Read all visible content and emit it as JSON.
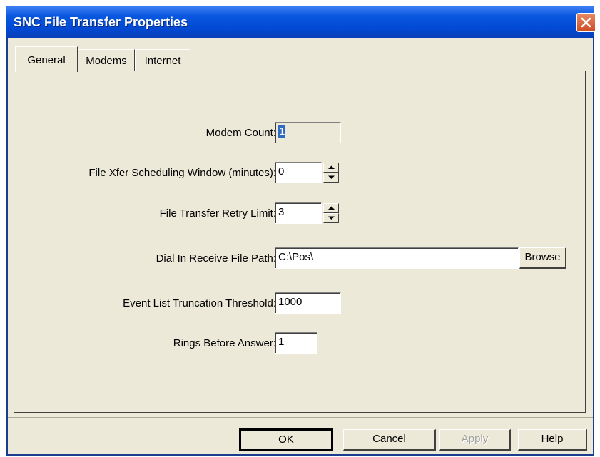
{
  "window": {
    "title": "SNC File Transfer Properties"
  },
  "tabs": [
    {
      "label": "General",
      "active": true
    },
    {
      "label": "Modems",
      "active": false
    },
    {
      "label": "Internet",
      "active": false
    }
  ],
  "fields": {
    "modem_count": {
      "label": "Modem Count:",
      "value": "1"
    },
    "scheduling_window": {
      "label": "File Xfer Scheduling Window (minutes):",
      "value": "0"
    },
    "retry_limit": {
      "label": "File Transfer Retry Limit:",
      "value": "3"
    },
    "receive_path": {
      "label": "Dial In Receive File Path:",
      "value": "C:\\Pos\\",
      "browse_label": "Browse"
    },
    "truncation_threshold": {
      "label": "Event List Truncation Threshold:",
      "value": "1000"
    },
    "rings_before_answer": {
      "label": "Rings Before Answer:",
      "value": "1"
    }
  },
  "buttons": {
    "ok": "OK",
    "cancel": "Cancel",
    "apply": "Apply",
    "help": "Help"
  },
  "colors": {
    "title_bar": "#0249d3",
    "dialog_face": "#ece9d8",
    "close_button": "#d04b22",
    "selection": "#316ac5"
  },
  "icons": {
    "close": "close-icon",
    "spin_up": "arrow-up-icon",
    "spin_down": "arrow-down-icon"
  }
}
